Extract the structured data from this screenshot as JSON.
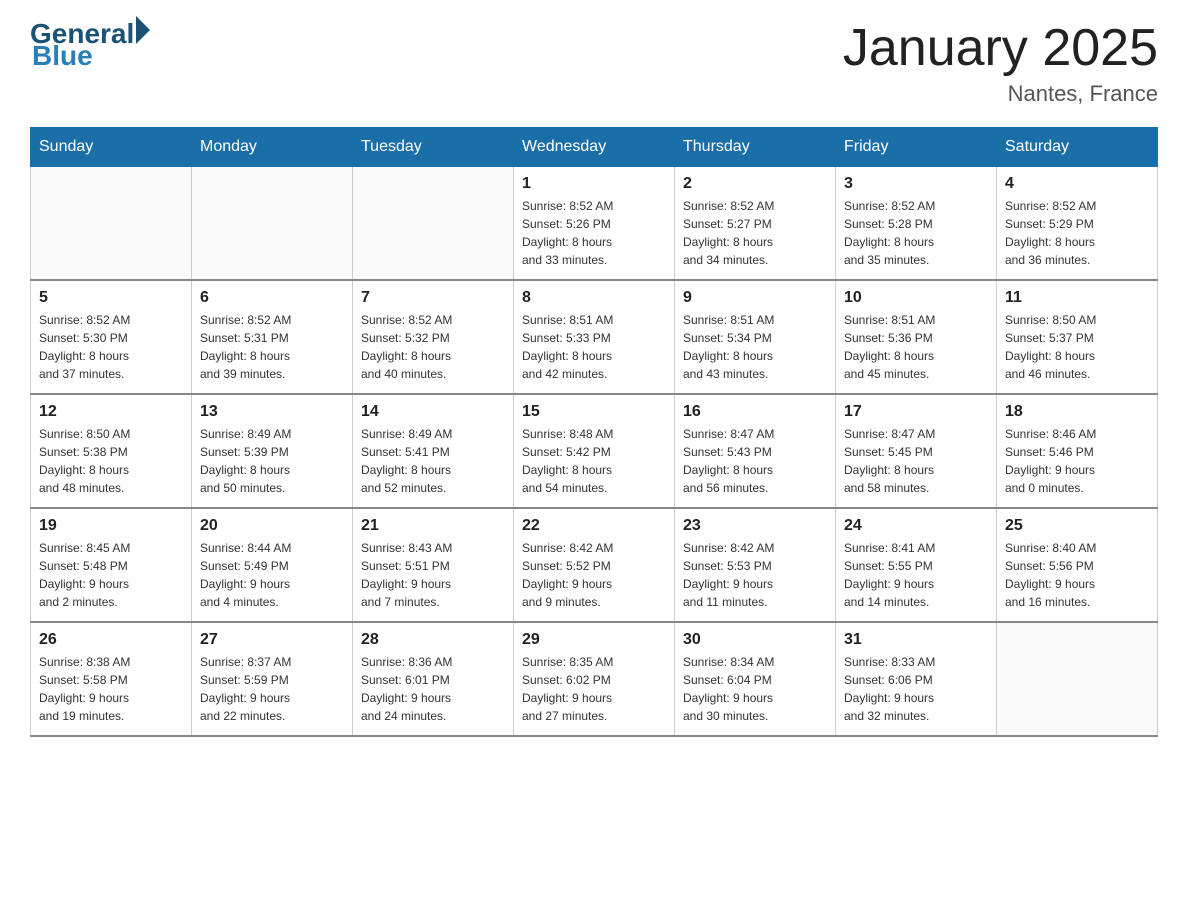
{
  "header": {
    "logo": {
      "general": "General",
      "blue": "Blue"
    },
    "title": "January 2025",
    "subtitle": "Nantes, France"
  },
  "weekdays": [
    "Sunday",
    "Monday",
    "Tuesday",
    "Wednesday",
    "Thursday",
    "Friday",
    "Saturday"
  ],
  "weeks": [
    [
      {
        "day": "",
        "info": ""
      },
      {
        "day": "",
        "info": ""
      },
      {
        "day": "",
        "info": ""
      },
      {
        "day": "1",
        "info": "Sunrise: 8:52 AM\nSunset: 5:26 PM\nDaylight: 8 hours\nand 33 minutes."
      },
      {
        "day": "2",
        "info": "Sunrise: 8:52 AM\nSunset: 5:27 PM\nDaylight: 8 hours\nand 34 minutes."
      },
      {
        "day": "3",
        "info": "Sunrise: 8:52 AM\nSunset: 5:28 PM\nDaylight: 8 hours\nand 35 minutes."
      },
      {
        "day": "4",
        "info": "Sunrise: 8:52 AM\nSunset: 5:29 PM\nDaylight: 8 hours\nand 36 minutes."
      }
    ],
    [
      {
        "day": "5",
        "info": "Sunrise: 8:52 AM\nSunset: 5:30 PM\nDaylight: 8 hours\nand 37 minutes."
      },
      {
        "day": "6",
        "info": "Sunrise: 8:52 AM\nSunset: 5:31 PM\nDaylight: 8 hours\nand 39 minutes."
      },
      {
        "day": "7",
        "info": "Sunrise: 8:52 AM\nSunset: 5:32 PM\nDaylight: 8 hours\nand 40 minutes."
      },
      {
        "day": "8",
        "info": "Sunrise: 8:51 AM\nSunset: 5:33 PM\nDaylight: 8 hours\nand 42 minutes."
      },
      {
        "day": "9",
        "info": "Sunrise: 8:51 AM\nSunset: 5:34 PM\nDaylight: 8 hours\nand 43 minutes."
      },
      {
        "day": "10",
        "info": "Sunrise: 8:51 AM\nSunset: 5:36 PM\nDaylight: 8 hours\nand 45 minutes."
      },
      {
        "day": "11",
        "info": "Sunrise: 8:50 AM\nSunset: 5:37 PM\nDaylight: 8 hours\nand 46 minutes."
      }
    ],
    [
      {
        "day": "12",
        "info": "Sunrise: 8:50 AM\nSunset: 5:38 PM\nDaylight: 8 hours\nand 48 minutes."
      },
      {
        "day": "13",
        "info": "Sunrise: 8:49 AM\nSunset: 5:39 PM\nDaylight: 8 hours\nand 50 minutes."
      },
      {
        "day": "14",
        "info": "Sunrise: 8:49 AM\nSunset: 5:41 PM\nDaylight: 8 hours\nand 52 minutes."
      },
      {
        "day": "15",
        "info": "Sunrise: 8:48 AM\nSunset: 5:42 PM\nDaylight: 8 hours\nand 54 minutes."
      },
      {
        "day": "16",
        "info": "Sunrise: 8:47 AM\nSunset: 5:43 PM\nDaylight: 8 hours\nand 56 minutes."
      },
      {
        "day": "17",
        "info": "Sunrise: 8:47 AM\nSunset: 5:45 PM\nDaylight: 8 hours\nand 58 minutes."
      },
      {
        "day": "18",
        "info": "Sunrise: 8:46 AM\nSunset: 5:46 PM\nDaylight: 9 hours\nand 0 minutes."
      }
    ],
    [
      {
        "day": "19",
        "info": "Sunrise: 8:45 AM\nSunset: 5:48 PM\nDaylight: 9 hours\nand 2 minutes."
      },
      {
        "day": "20",
        "info": "Sunrise: 8:44 AM\nSunset: 5:49 PM\nDaylight: 9 hours\nand 4 minutes."
      },
      {
        "day": "21",
        "info": "Sunrise: 8:43 AM\nSunset: 5:51 PM\nDaylight: 9 hours\nand 7 minutes."
      },
      {
        "day": "22",
        "info": "Sunrise: 8:42 AM\nSunset: 5:52 PM\nDaylight: 9 hours\nand 9 minutes."
      },
      {
        "day": "23",
        "info": "Sunrise: 8:42 AM\nSunset: 5:53 PM\nDaylight: 9 hours\nand 11 minutes."
      },
      {
        "day": "24",
        "info": "Sunrise: 8:41 AM\nSunset: 5:55 PM\nDaylight: 9 hours\nand 14 minutes."
      },
      {
        "day": "25",
        "info": "Sunrise: 8:40 AM\nSunset: 5:56 PM\nDaylight: 9 hours\nand 16 minutes."
      }
    ],
    [
      {
        "day": "26",
        "info": "Sunrise: 8:38 AM\nSunset: 5:58 PM\nDaylight: 9 hours\nand 19 minutes."
      },
      {
        "day": "27",
        "info": "Sunrise: 8:37 AM\nSunset: 5:59 PM\nDaylight: 9 hours\nand 22 minutes."
      },
      {
        "day": "28",
        "info": "Sunrise: 8:36 AM\nSunset: 6:01 PM\nDaylight: 9 hours\nand 24 minutes."
      },
      {
        "day": "29",
        "info": "Sunrise: 8:35 AM\nSunset: 6:02 PM\nDaylight: 9 hours\nand 27 minutes."
      },
      {
        "day": "30",
        "info": "Sunrise: 8:34 AM\nSunset: 6:04 PM\nDaylight: 9 hours\nand 30 minutes."
      },
      {
        "day": "31",
        "info": "Sunrise: 8:33 AM\nSunset: 6:06 PM\nDaylight: 9 hours\nand 32 minutes."
      },
      {
        "day": "",
        "info": ""
      }
    ]
  ]
}
